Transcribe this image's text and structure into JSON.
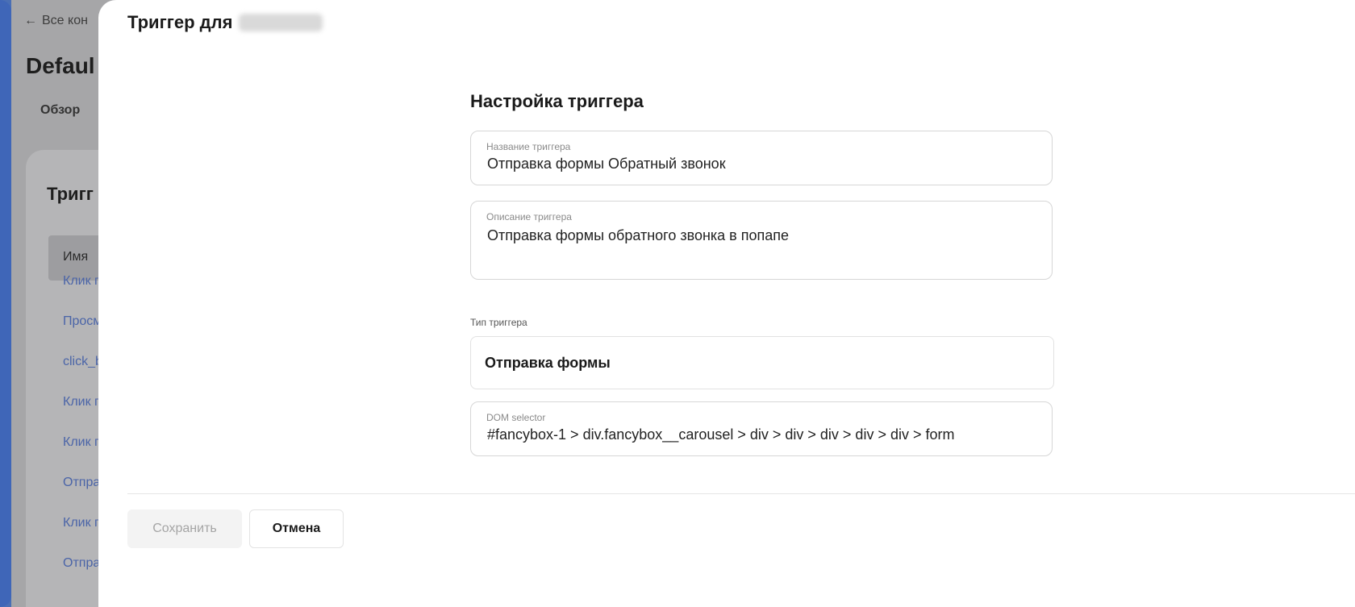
{
  "background": {
    "back_link": "Все кон",
    "back_arrow": "←",
    "page_title": "Defaul",
    "tab_overview": "Обзор",
    "card_title": "Тригг",
    "table_header": "Имя",
    "rows": [
      "Клик п",
      "Просм",
      "click_b",
      "Клик п",
      "Клик п",
      "Отпра",
      "Клик п",
      "Отпра"
    ]
  },
  "modal": {
    "title": "Триггер для",
    "section_title": "Настройка триггера",
    "name_field": {
      "label": "Название триггера",
      "value": "Отправка формы Обратный звонок"
    },
    "description_field": {
      "label": "Описание триггера",
      "value": "Отправка формы обратного звонка в попапе"
    },
    "type_label": "Тип триггера",
    "type_value": "Отправка формы",
    "selector_field": {
      "label": "DOM selector",
      "value": "#fancybox-1 > div.fancybox__carousel > div > div > div > div > div > form"
    },
    "save_button": "Сохранить",
    "cancel_button": "Отмена"
  }
}
